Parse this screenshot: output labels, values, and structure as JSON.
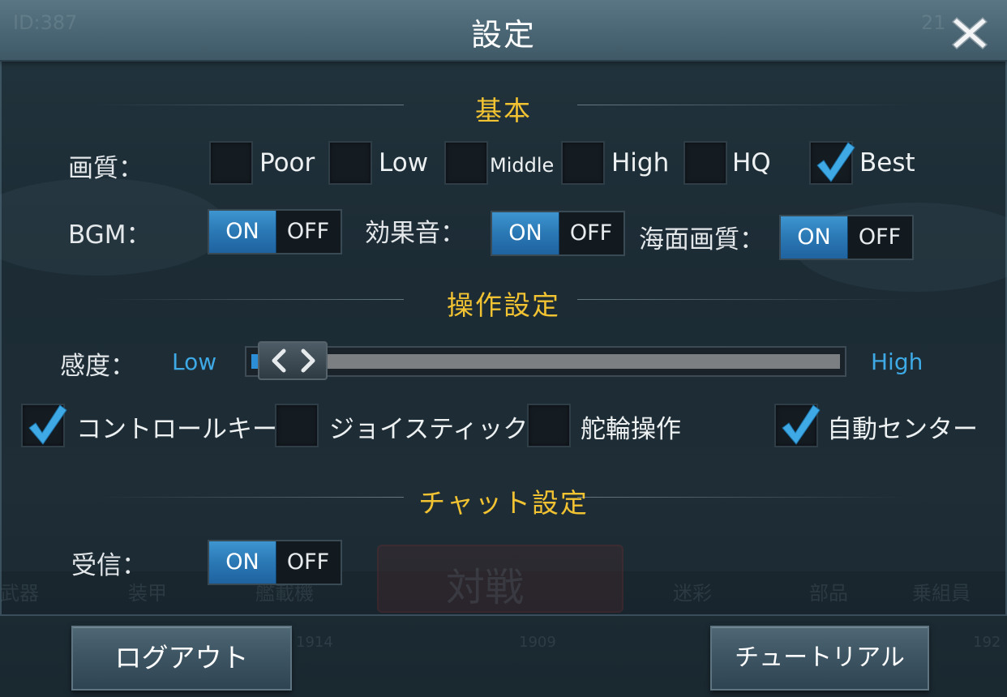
{
  "header": {
    "title": "設定",
    "faint_left": "ID:387",
    "faint_right": "21"
  },
  "background": {
    "battle_label": "対戦",
    "tabs": [
      "武器",
      "装甲",
      "艦載機",
      "迷彩",
      "部品",
      "乗組員"
    ],
    "numbers": [
      "1914",
      "1909",
      "192"
    ]
  },
  "sections": {
    "basic": "基本",
    "controls": "操作設定",
    "chat": "チャット設定"
  },
  "quality": {
    "label": "画質：",
    "options": [
      {
        "label": "Poor",
        "checked": false
      },
      {
        "label": "Low",
        "checked": false
      },
      {
        "label": "Middle",
        "checked": false
      },
      {
        "label": "High",
        "checked": false
      },
      {
        "label": "HQ",
        "checked": false
      },
      {
        "label": "Best",
        "checked": true
      }
    ]
  },
  "audio": {
    "bgm_label": "BGM：",
    "se_label": "効果音：",
    "sea_label": "海面画質：",
    "on_label": "ON",
    "off_label": "OFF",
    "bgm_on": true,
    "se_on": true,
    "sea_on": true
  },
  "sensitivity": {
    "label": "感度：",
    "low_label": "Low",
    "high_label": "High",
    "value": 0.0
  },
  "control_options": [
    {
      "label": "コントロールキー",
      "checked": true
    },
    {
      "label": "ジョイスティック",
      "checked": false
    },
    {
      "label": "舵輪操作",
      "checked": false
    },
    {
      "label": "自動センター",
      "checked": true
    }
  ],
  "chat": {
    "receive_label": "受信：",
    "on_label": "ON",
    "off_label": "OFF",
    "receive_on": true
  },
  "buttons": {
    "logout": "ログアウト",
    "tutorial": "チュートリアル"
  },
  "colors": {
    "section_title": "#f1c232",
    "toggle_on": "#2a78b5",
    "check": "#3ea9e4",
    "slider_label": "#3ea9e4"
  },
  "icons": {
    "close": "close-icon",
    "check": "check-icon",
    "slider_thumb": "chevron-left-right-icon"
  }
}
